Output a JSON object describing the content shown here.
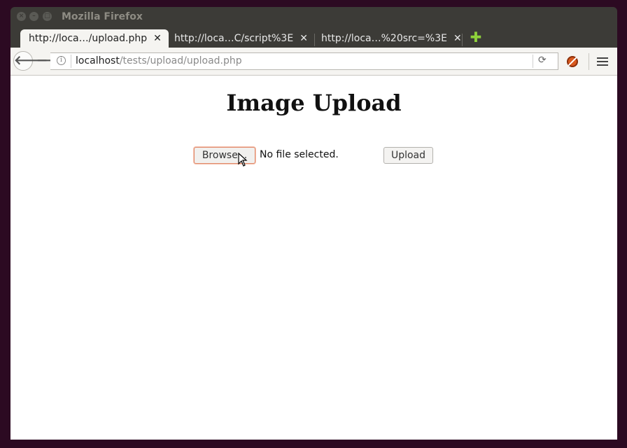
{
  "window": {
    "title": "Mozilla Firefox",
    "controls": {
      "close": "×",
      "minimize": "–",
      "maximize": "□"
    }
  },
  "tabs": [
    {
      "title": "http://loca…/upload.php",
      "close": "✕",
      "active": true
    },
    {
      "title": "http://loca…C/script%3E",
      "close": "✕",
      "active": false
    },
    {
      "title": "http://loca…%20src=%3E",
      "close": "✕",
      "active": false
    }
  ],
  "new_tab": {
    "label": "✚",
    "icon": "plus-icon",
    "color": "#8ed13b"
  },
  "navbar": {
    "back": "🡐",
    "forward": "🡒",
    "url_host": "localhost",
    "url_path": "/tests/upload/upload.php",
    "info": "i",
    "reload": "⟳",
    "addon_icon": "no-script-icon",
    "menu_icon": "hamburger-menu-icon"
  },
  "page": {
    "heading": "Image Upload",
    "browse_label": "Browse...",
    "file_status": "No file selected.",
    "upload_label": "Upload"
  },
  "colors": {
    "desktop": "#2c0a22",
    "titlebar": "#3c3b37",
    "active_tab": "#f5f4f1",
    "browse_border": "#e08a6b"
  }
}
